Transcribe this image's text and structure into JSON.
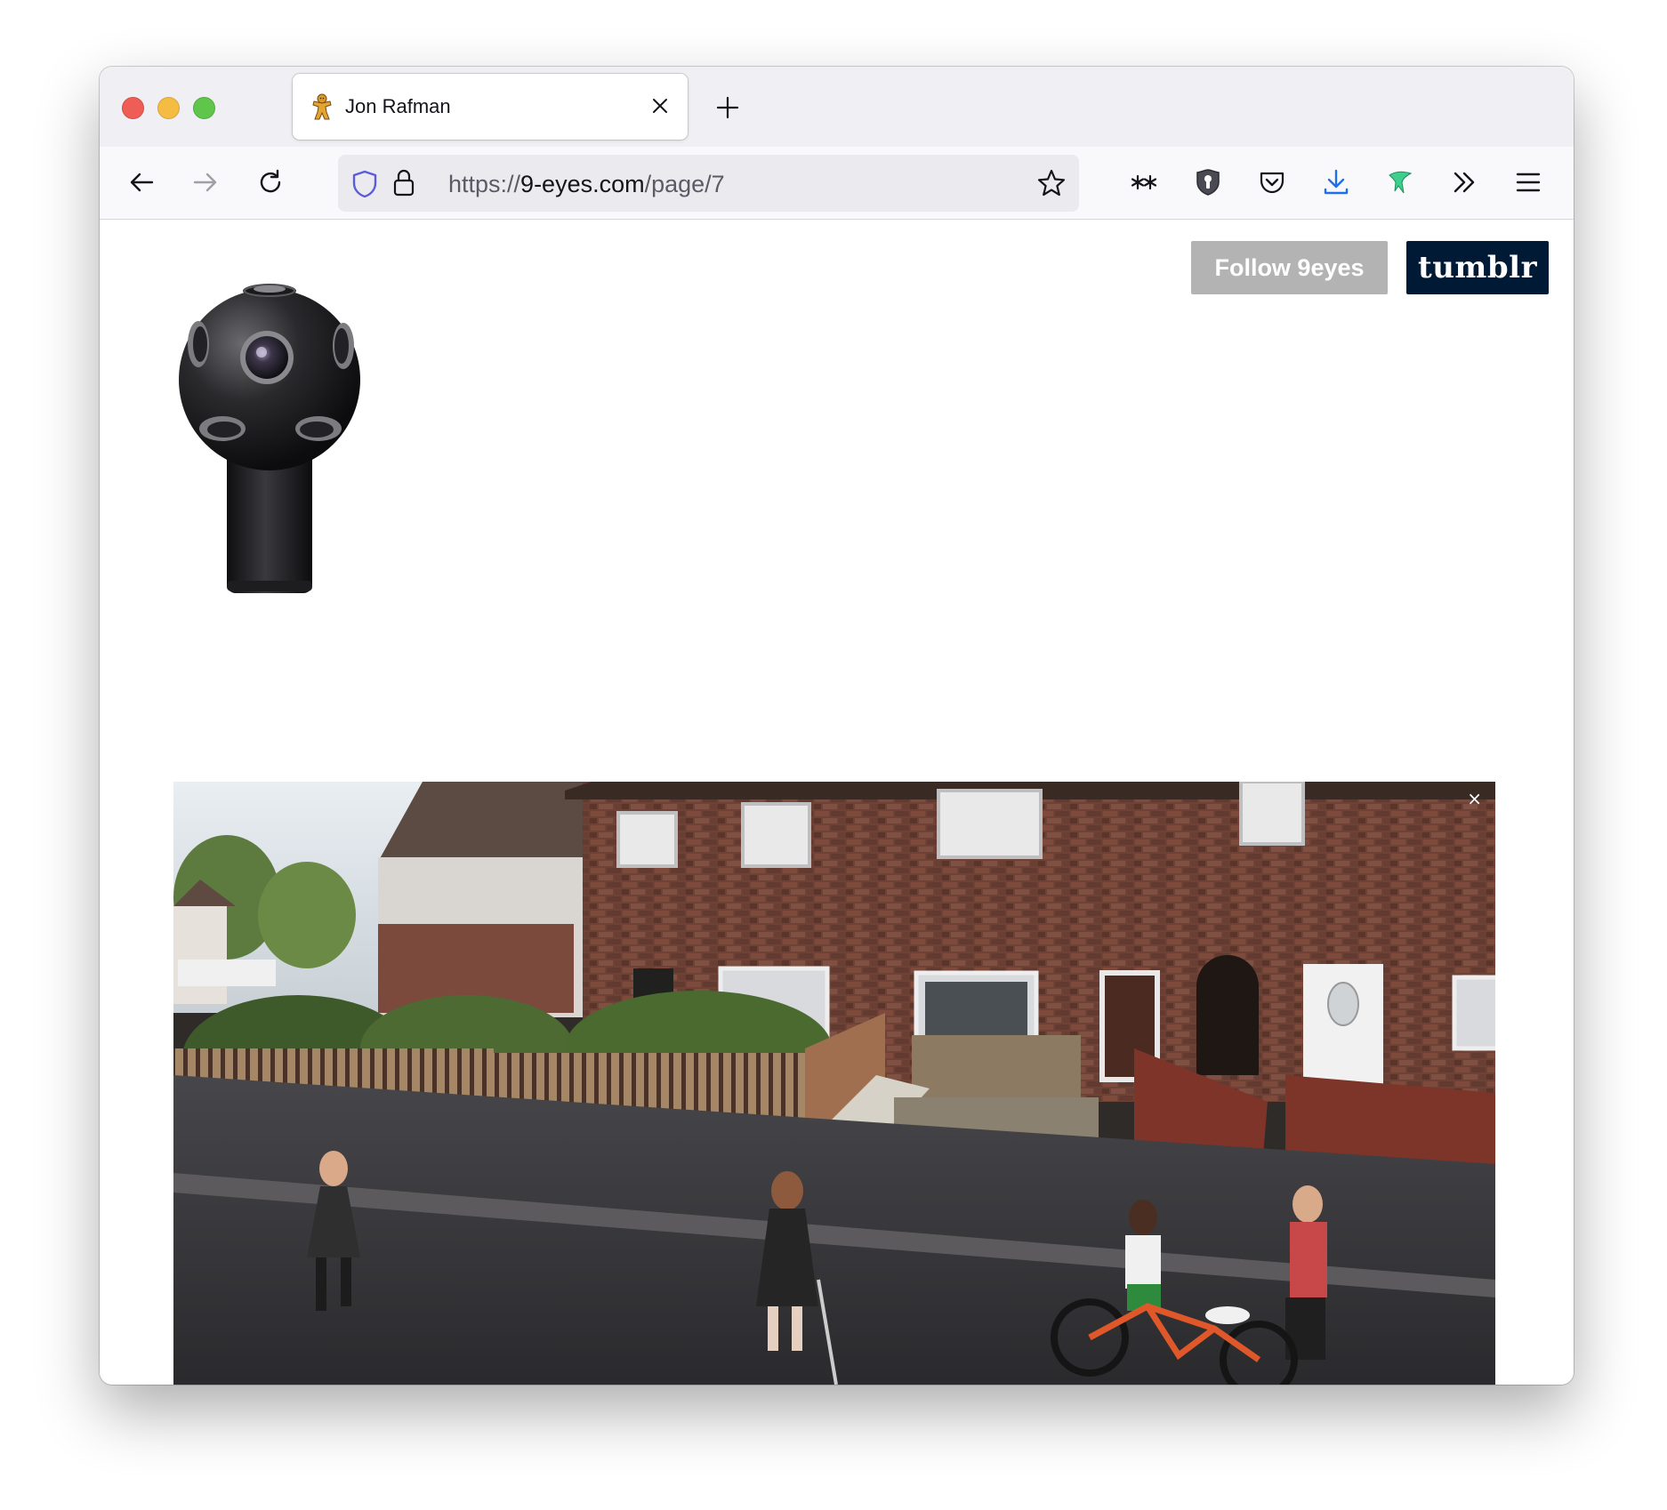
{
  "browser": {
    "tab": {
      "title": "Jon Rafman"
    },
    "url": {
      "scheme": "https://",
      "host": "9-eyes.com",
      "path": "/page/7"
    }
  },
  "page": {
    "follow_label": "Follow 9eyes",
    "tumblr_label": "tumblr",
    "photo_close_glyph": "×",
    "photo_description": "Street View image of children on a residential street in front of brick terraced houses"
  },
  "colors": {
    "follow_button": "#b3b3b3",
    "tumblr_button": "#001935",
    "shield_icon": "#5b5bdc",
    "download_icon": "#1f6feb",
    "green_extension_icon": "#3ecf8e"
  }
}
